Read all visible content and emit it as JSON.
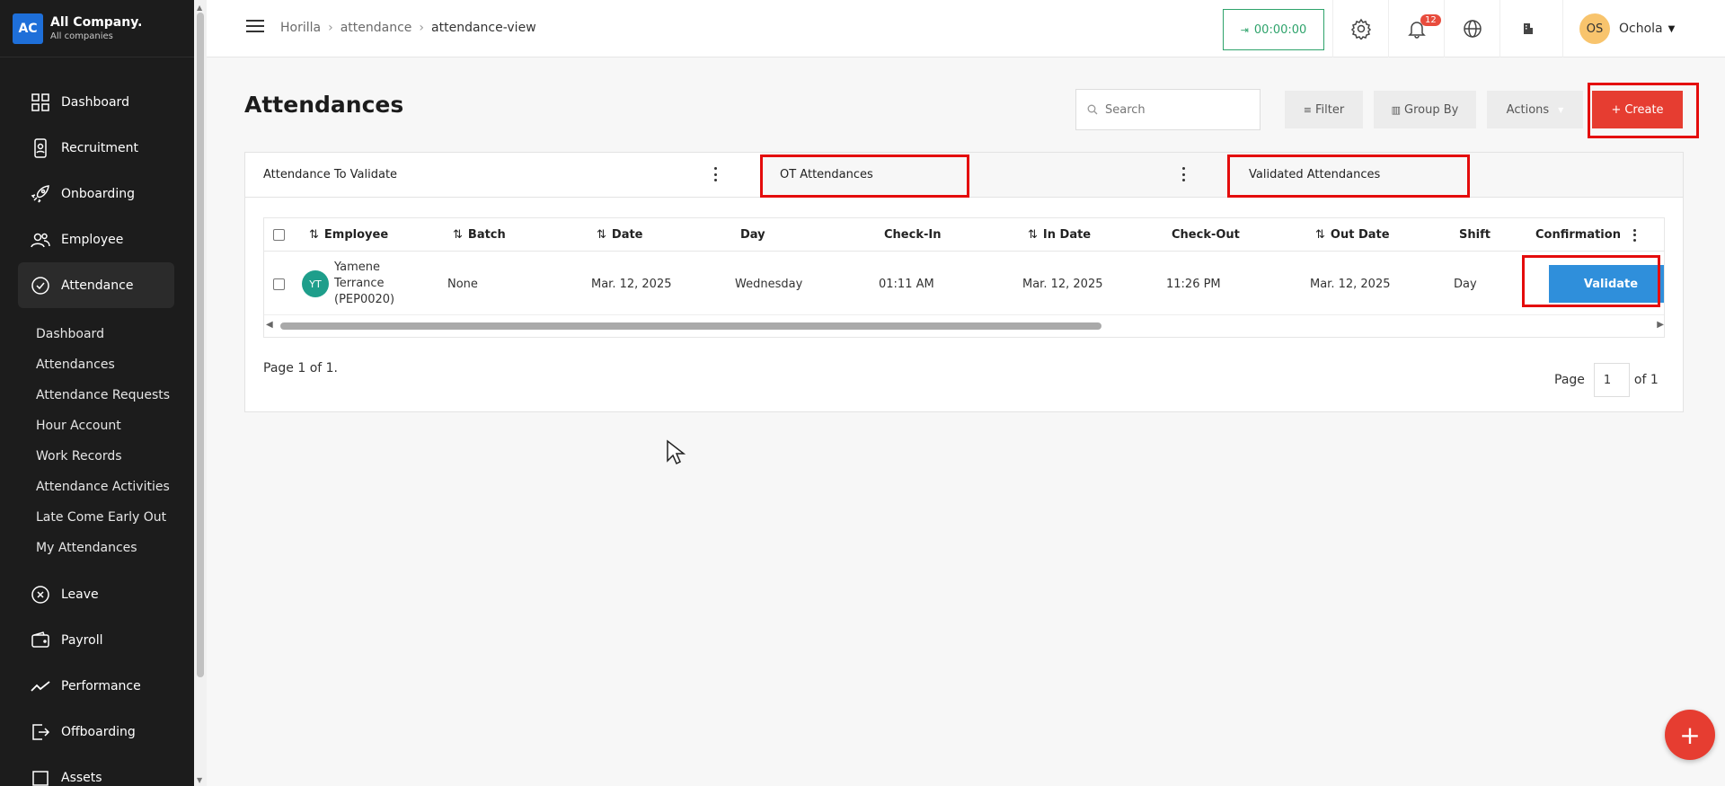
{
  "company": {
    "logo_text": "AC",
    "name": "All Company.",
    "sub": "All companies"
  },
  "sidebar": {
    "main": [
      {
        "label": "Dashboard",
        "icon": "dashboard-icon"
      },
      {
        "label": "Recruitment",
        "icon": "recruitment-icon"
      },
      {
        "label": "Onboarding",
        "icon": "rocket-icon"
      },
      {
        "label": "Employee",
        "icon": "people-icon"
      },
      {
        "label": "Attendance",
        "icon": "check-circle-icon"
      }
    ],
    "attendance_sub": [
      "Dashboard",
      "Attendances",
      "Attendance Requests",
      "Hour Account",
      "Work Records",
      "Attendance Activities",
      "Late Come Early Out",
      "My Attendances"
    ],
    "lower": [
      {
        "label": "Leave",
        "icon": "leave-icon"
      },
      {
        "label": "Payroll",
        "icon": "wallet-icon"
      },
      {
        "label": "Performance",
        "icon": "trend-icon"
      },
      {
        "label": "Offboarding",
        "icon": "exit-icon"
      },
      {
        "label": "Assets",
        "icon": "assets-icon"
      }
    ]
  },
  "header": {
    "breadcrumb": [
      "Horilla",
      "attendance",
      "attendance-view"
    ],
    "timer": "00:00:00",
    "notification_count": "12",
    "user": {
      "initials": "OS",
      "name": "Ochola"
    }
  },
  "toolbar": {
    "title": "Attendances",
    "search_placeholder": "Search",
    "filter": "Filter",
    "group_by": "Group By",
    "actions": "Actions",
    "create": "Create"
  },
  "tabs": [
    "Attendance To Validate",
    "OT Attendances",
    "Validated Attendances"
  ],
  "table": {
    "headers": [
      "Employee",
      "Batch",
      "Date",
      "Day",
      "Check-In",
      "In Date",
      "Check-Out",
      "Out Date",
      "Shift",
      "Confirmation"
    ],
    "rows": [
      {
        "initials": "YT",
        "employee": "Yamene Terrance (PEP0020)",
        "batch": "None",
        "date": "Mar. 12, 2025",
        "day": "Wednesday",
        "check_in": "01:11 AM",
        "in_date": "Mar. 12, 2025",
        "check_out": "11:26 PM",
        "out_date": "Mar. 12, 2025",
        "shift": "Day",
        "action": "Validate"
      }
    ]
  },
  "pagination": {
    "info": "Page 1 of 1.",
    "page_label": "Page",
    "current": "1",
    "of": "of 1"
  },
  "fab": "+"
}
